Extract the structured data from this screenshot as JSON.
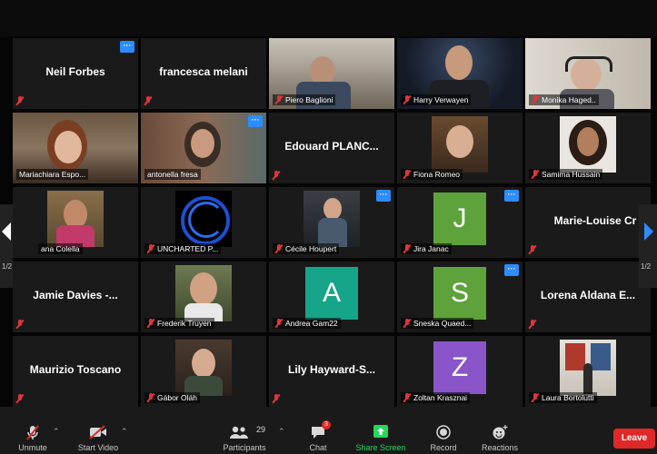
{
  "tiles": {
    "neil": {
      "name": "Neil Forbes"
    },
    "francesca": {
      "name": "francesca melani"
    },
    "piero": {
      "label": "Piero Baglioni"
    },
    "harry": {
      "label": "Harry Verwayen"
    },
    "monika": {
      "label": "Monika Haged.."
    },
    "mariachiara": {
      "label": "Mariachiara Espo..."
    },
    "antonella": {
      "label": "antonella fresa"
    },
    "edouard": {
      "name": "Edouard  PLANC..."
    },
    "fiona": {
      "label": "Fiona Romeo"
    },
    "samima": {
      "label": "Samima Hussain"
    },
    "ana": {
      "label": "ana Colella"
    },
    "uncharted": {
      "label": "UNCHARTED P..."
    },
    "cecile": {
      "label": "Cécile Houpert"
    },
    "jira": {
      "label": "Jira Janac",
      "initial": "J"
    },
    "marielouise": {
      "name": "Marie-Louise  Cr"
    },
    "jamie": {
      "name": "Jamie Davies -..."
    },
    "frederik": {
      "label": "Frederik Truyen"
    },
    "andrea": {
      "label": "Andrea Gam22",
      "initial": "A"
    },
    "sneska": {
      "label": "Sneska Quaed...",
      "initial": "S"
    },
    "lorena": {
      "name": "Lorena Aldana E..."
    },
    "maurizio": {
      "name": "Maurizio Toscano"
    },
    "gabor": {
      "label": "Gábor Oláh"
    },
    "lily": {
      "name": "Lily  Hayward-S..."
    },
    "zoltan": {
      "label": "Zoltan Krasznai",
      "initial": "Z"
    },
    "laura": {
      "label": "Laura Bortolutti"
    }
  },
  "pagination": {
    "left": "1/2",
    "right": "1/2"
  },
  "toolbar": {
    "unmute": "Unmute",
    "start_video": "Start Video",
    "participants": "Participants",
    "participants_count": "29",
    "chat": "Chat",
    "chat_badge": "3",
    "share_screen": "Share Screen",
    "record": "Record",
    "reactions": "Reactions",
    "leave": "Leave"
  },
  "more_glyph": "···",
  "colors": {
    "accent_blue": "#2d8cff",
    "leave_red": "#e02828",
    "active_speaker": "#d9e27a",
    "share_green": "#23d959",
    "avatar_teal": "#17a589",
    "avatar_green": "#5da23a",
    "avatar_purple": "#8a55c8"
  }
}
